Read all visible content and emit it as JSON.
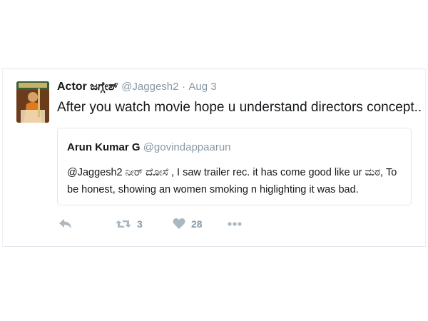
{
  "tweet": {
    "name": "Actor ಜಗ್ಗೇಶ್",
    "handle": "@Jaggesh2",
    "separator": "·",
    "date": "Aug 3",
    "text": "After you watch movie hope u understand directors concept.."
  },
  "quoted_tweet": {
    "name": "Arun Kumar G",
    "handle": "@govindappaarun",
    "text": "@Jaggesh2 ನೀರ್ ದೋಸೆ , I saw trailer rec. it has come good like ur ಮಠ, To be honest, showing an women smoking n higlighting it was bad."
  },
  "actions": {
    "reply_icon": "reply-icon",
    "retweet_icon": "retweet-icon",
    "retweet_count": "3",
    "like_icon": "heart-icon",
    "like_count": "28",
    "more_icon": "more-icon"
  },
  "colors": {
    "text": "#14171a",
    "muted": "#8899a6",
    "icon": "#aab8c2",
    "border": "#e1e8ed"
  }
}
